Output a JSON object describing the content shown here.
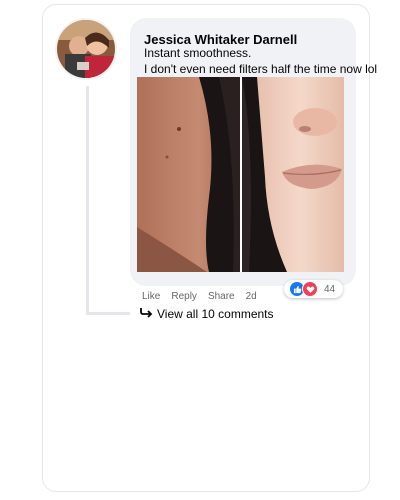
{
  "comment": {
    "author": "Jessica Whitaker Darnell",
    "text_line1": "Instant smoothness.",
    "text_line2": "I don't even need filters half the time now lol"
  },
  "actions": {
    "like": "Like",
    "reply": "Reply",
    "share": "Share",
    "timestamp": "2d"
  },
  "reactions": {
    "count": "44",
    "types": [
      "like-icon",
      "love-icon"
    ],
    "colors": {
      "like": "#1877f2",
      "love": "#f33e58"
    }
  },
  "view_all": {
    "label": "View all 10 comments"
  }
}
